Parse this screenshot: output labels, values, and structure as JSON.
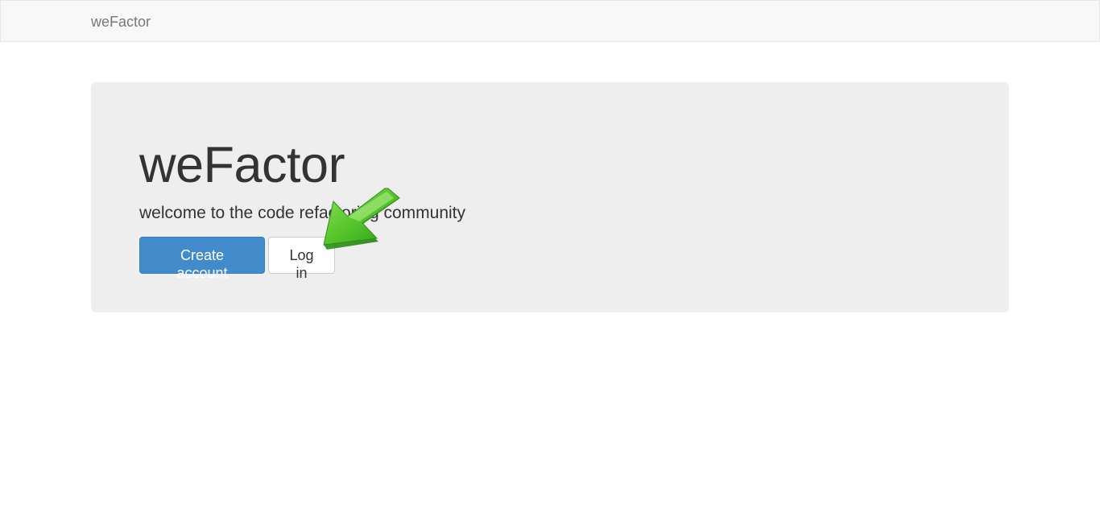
{
  "navbar": {
    "brand": "weFactor"
  },
  "hero": {
    "title": "weFactor",
    "subtitle": "welcome to the code refactoring community",
    "primary_button": "Create account",
    "secondary_button": "Log in"
  },
  "annotation": {
    "icon": "green-arrow-icon",
    "color": "#4cbf25"
  },
  "colors": {
    "navbar_bg": "#f8f8f8",
    "jumbotron_bg": "#eeeeee",
    "primary": "#428bca"
  }
}
